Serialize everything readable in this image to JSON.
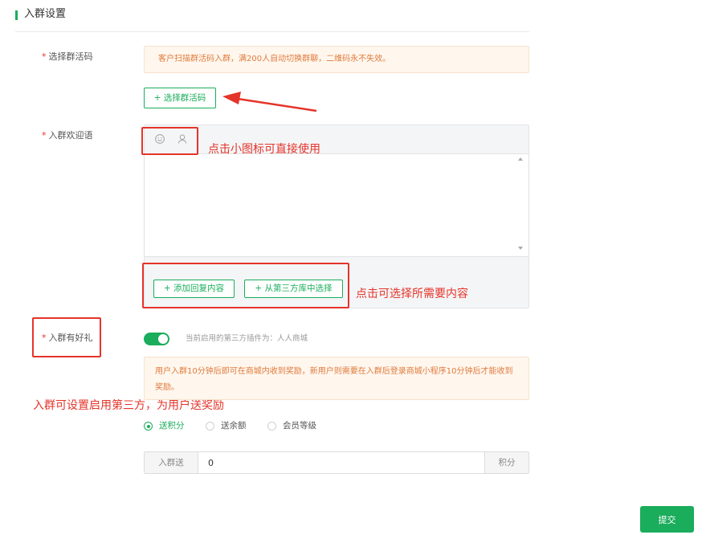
{
  "section": {
    "title": "入群设置"
  },
  "group_code": {
    "label": "选择群活码",
    "tip": "客户扫描群活码入群，满200人自动切换群聊，二维码永不失效。",
    "button": "+ 选择群活码"
  },
  "welcome": {
    "label": "入群欢迎语",
    "icons": [
      "smile-icon",
      "user-icon"
    ],
    "textarea_value": "",
    "add_reply_button": "+ 添加回复内容",
    "third_party_button": "+ 从第三方库中选择"
  },
  "gift": {
    "label": "入群有好礼",
    "toggle_on": true,
    "plugin_text": "当前启用的第三方插件为：人人商城",
    "tip": "用户入群10分钟后即可在商城内收到奖励，新用户则需要在入群后登录商城小程序10分钟后才能收到奖励。",
    "options": [
      {
        "label": "送积分",
        "selected": true
      },
      {
        "label": "送余额",
        "selected": false
      },
      {
        "label": "会员等级",
        "selected": false
      }
    ],
    "input_prefix": "入群送",
    "input_value": "0",
    "input_suffix": "积分"
  },
  "annotations": {
    "icons_hint": "点击小图标可直接使用",
    "content_hint": "点击可选择所需要内容",
    "gift_hint": "入群可设置启用第三方，为用户送奖励"
  },
  "submit_label": "提交",
  "colors": {
    "accent": "#1aad5b",
    "annotation": "#e5342a",
    "tip_text": "#e07a3c"
  }
}
